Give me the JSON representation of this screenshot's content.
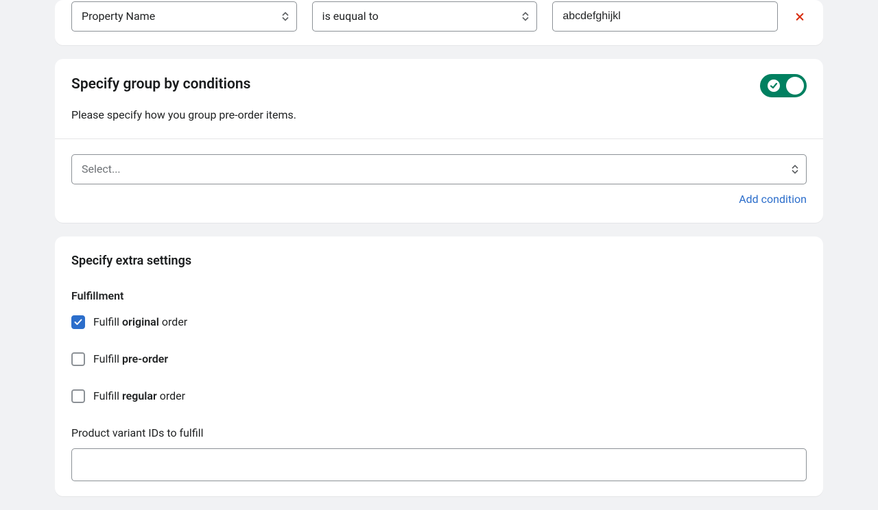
{
  "filter": {
    "property_label": "Property Name",
    "operator_label": "is euqual to",
    "value": "abcdefghijkl"
  },
  "group_by": {
    "title": "Specify group by conditions",
    "description": "Please specify how you group pre-order items.",
    "select_placeholder": "Select...",
    "add_condition_label": "Add condition",
    "toggle_on": true
  },
  "extra": {
    "title": "Specify extra settings",
    "fulfillment_label": "Fulfillment",
    "fulfill_original_prefix": "Fulfill ",
    "fulfill_original_bold": "original",
    "fulfill_original_suffix": " order",
    "fulfill_preorder_prefix": "Fulfill ",
    "fulfill_preorder_bold": "pre-order",
    "fulfill_preorder_suffix": "",
    "fulfill_regular_prefix": "Fulfill ",
    "fulfill_regular_bold": "regular",
    "fulfill_regular_suffix": " order",
    "variant_ids_label": "Product variant IDs to fulfill"
  }
}
